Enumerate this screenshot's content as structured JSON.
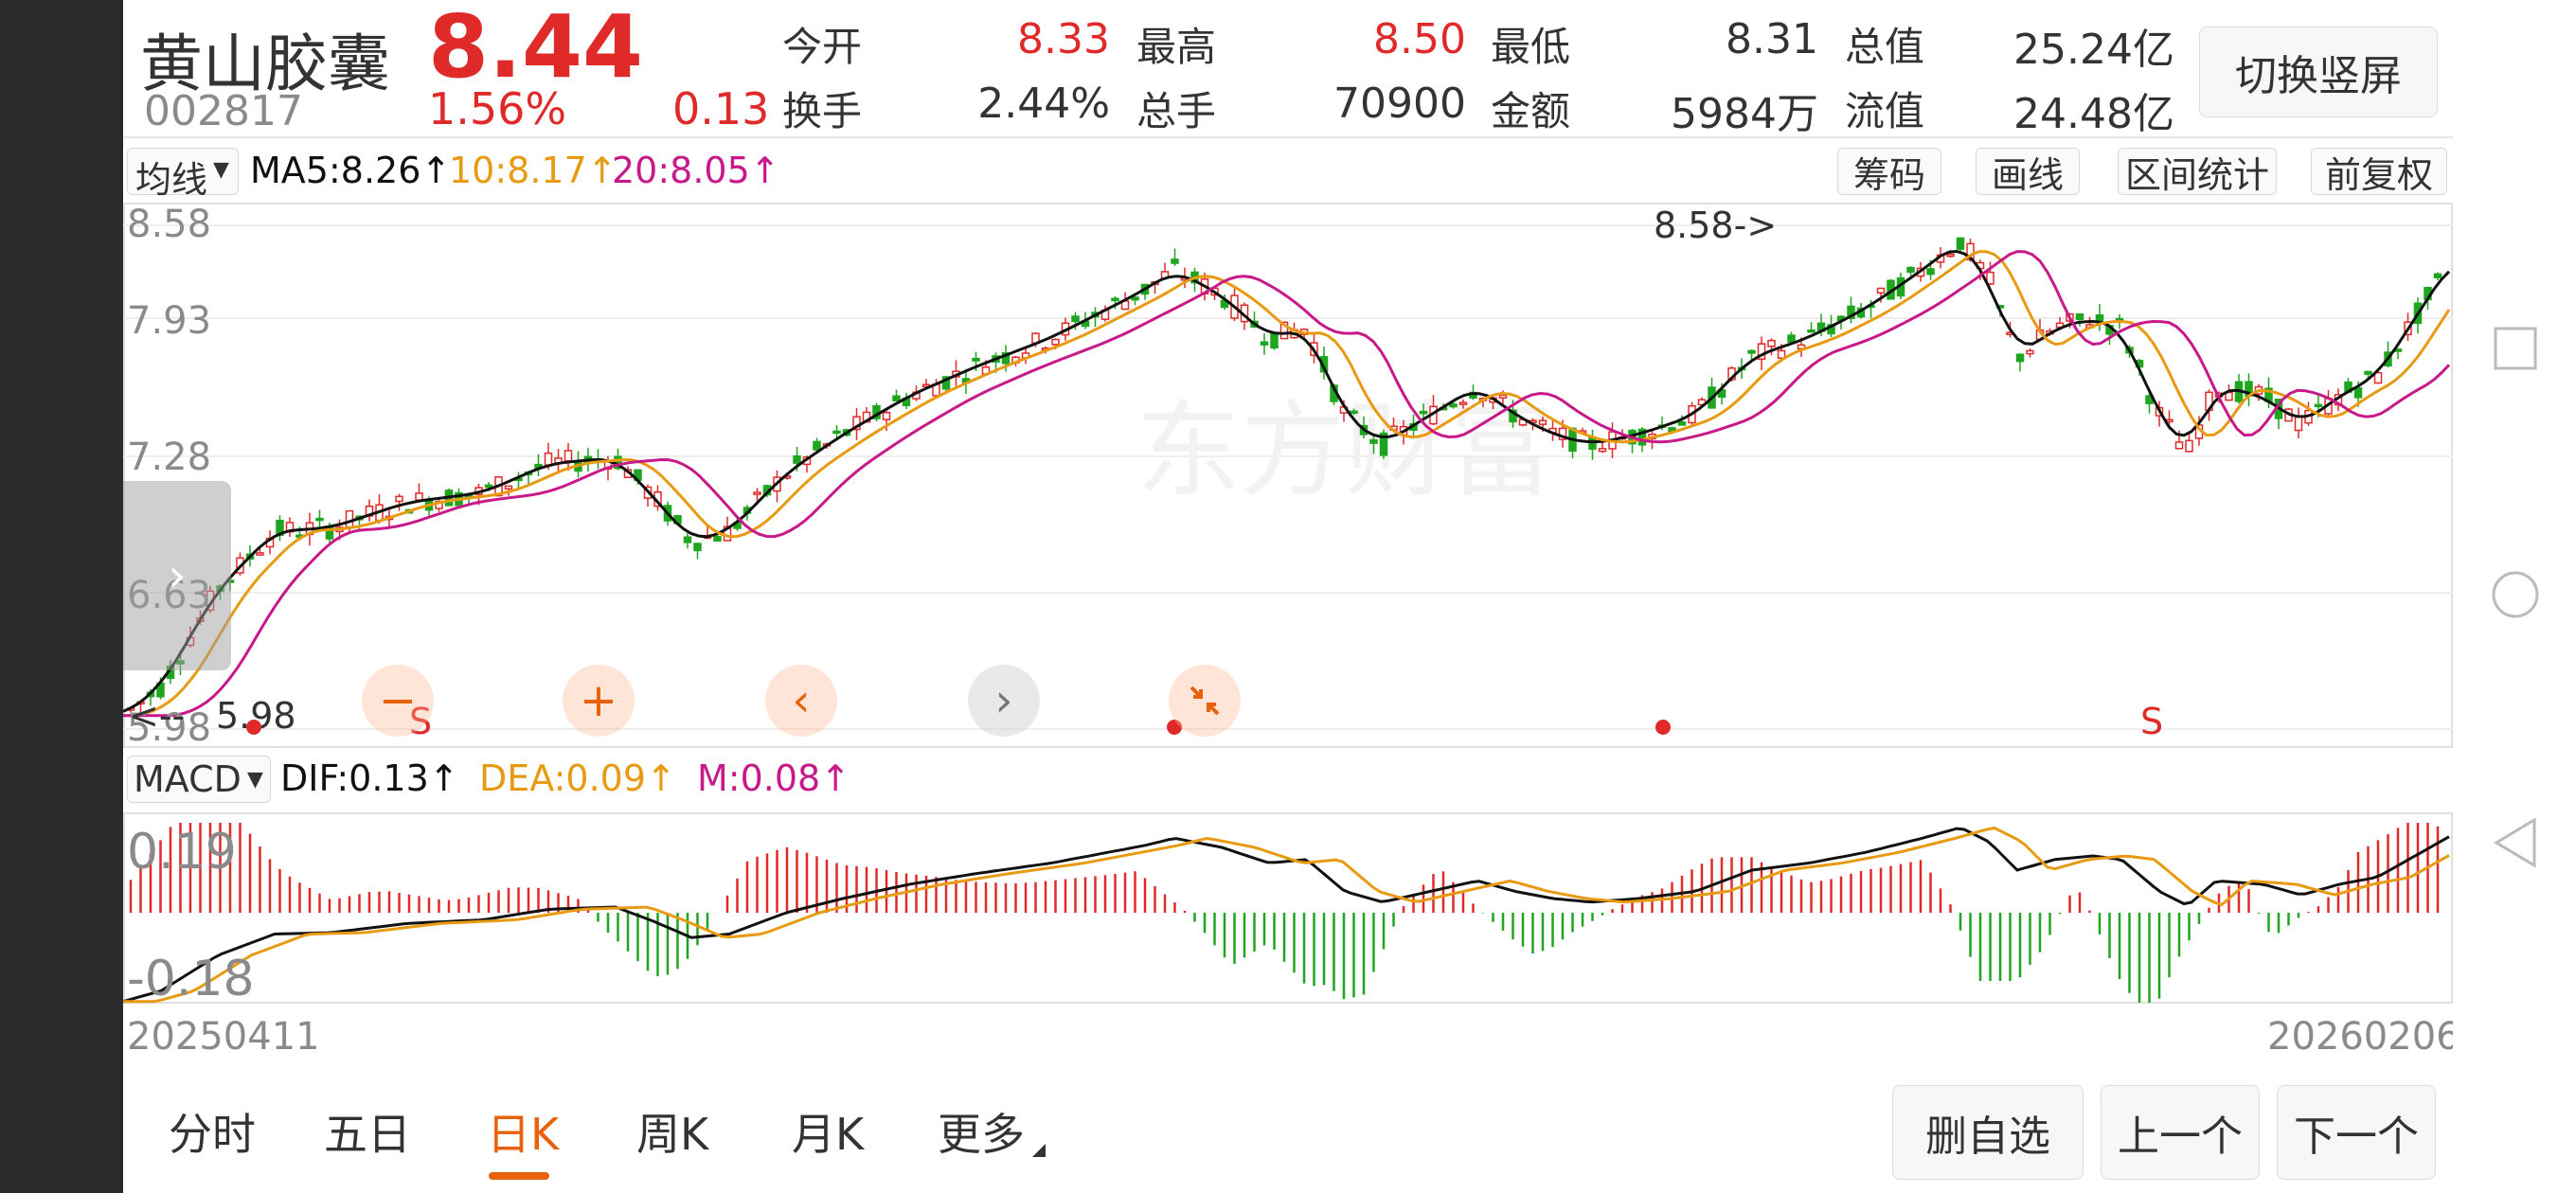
{
  "header": {
    "name": "黄山胶囊",
    "code": "002817",
    "price": "8.44",
    "change_pct": "1.56%",
    "change": "0.13",
    "stats": [
      {
        "label": "今开",
        "value": "8.33"
      },
      {
        "label": "最高",
        "value": "8.50"
      },
      {
        "label": "最低",
        "value": "8.31"
      },
      {
        "label": "总值",
        "value": "25.24亿"
      },
      {
        "label": "换手",
        "value": "2.44%"
      },
      {
        "label": "总手",
        "value": "70900"
      },
      {
        "label": "金额",
        "value": "5984万"
      },
      {
        "label": "流值",
        "value": "24.48亿"
      }
    ],
    "switch_btn": "切换竖屏"
  },
  "toolbar": {
    "indicator": "均线",
    "ma5": "MA5:8.26↑",
    "ma10": "10:8.17↑",
    "ma20": "20:8.05↑",
    "buttons": [
      "筹码",
      "画线",
      "区间统计",
      "前复权"
    ]
  },
  "kline": {
    "y_ticks": [
      "8.58",
      "7.93",
      "7.28",
      "6.63",
      "5.98"
    ],
    "high_label": "8.58->",
    "low_label": "5.98",
    "low_prefix": "<--",
    "signals": [
      "S",
      "S"
    ],
    "watermark": "东方财富"
  },
  "macd": {
    "indicator": "MACD",
    "dif": "DIF:0.13↑",
    "dea": "DEA:0.09↑",
    "m": "M:0.08↑",
    "y_ticks": [
      "0.19",
      "-0.18"
    ]
  },
  "dates": {
    "start": "20250411",
    "end": "20260206"
  },
  "controls": {
    "zoom_out": "−",
    "zoom_in": "+",
    "prev": "‹",
    "next": "›"
  },
  "tabs": [
    "分时",
    "五日",
    "日K",
    "周K",
    "月K",
    "更多"
  ],
  "active_tab": "日K",
  "bottom_buttons": {
    "remove": "删自选",
    "prev": "上一个",
    "next": "下一个"
  },
  "colors": {
    "up": "#e02a2a",
    "down": "#1fa51f",
    "ma5": "#111111",
    "ma10": "#e89a13",
    "ma20": "#c8198a",
    "active": "#e8620c"
  },
  "icons": [
    "recent-apps-icon",
    "home-icon",
    "back-icon",
    "chevron-right-icon",
    "collapse-icon",
    "dropdown-arrow-icon"
  ]
}
